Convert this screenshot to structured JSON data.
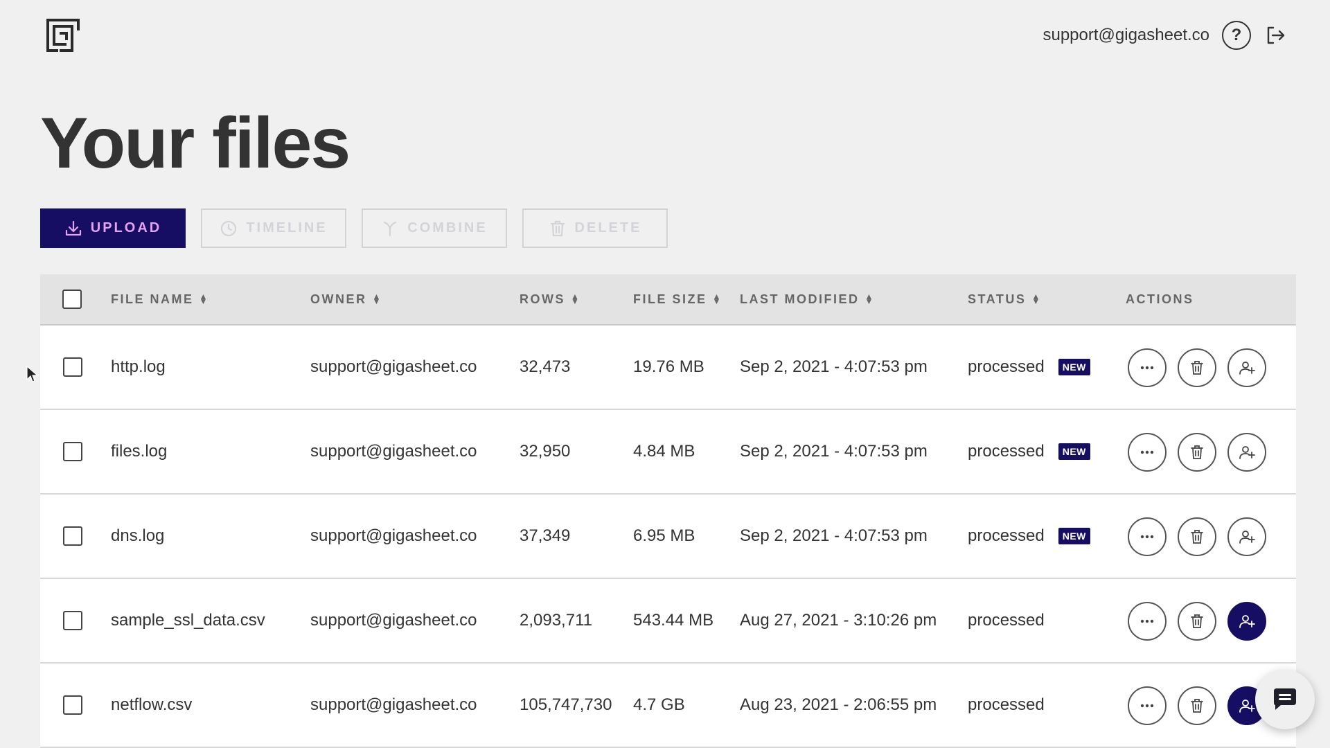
{
  "header": {
    "user_email": "support@gigasheet.co",
    "help_label": "?"
  },
  "page": {
    "title": "Your files"
  },
  "toolbar": {
    "upload": "UPLOAD",
    "timeline": "TIMELINE",
    "combine": "COMBINE",
    "delete": "DELETE"
  },
  "table": {
    "headers": {
      "file_name": "FILE NAME",
      "owner": "OWNER",
      "rows": "ROWS",
      "file_size": "FILE SIZE",
      "last_modified": "LAST MODIFIED",
      "status": "STATUS",
      "actions": "ACTIONS"
    },
    "rows": [
      {
        "name": "http.log",
        "owner": "support@gigasheet.co",
        "rows": "32,473",
        "size": "19.76 MB",
        "modified": "Sep 2, 2021 - 4:07:53 pm",
        "status": "processed",
        "badge": "NEW"
      },
      {
        "name": "files.log",
        "owner": "support@gigasheet.co",
        "rows": "32,950",
        "size": "4.84 MB",
        "modified": "Sep 2, 2021 - 4:07:53 pm",
        "status": "processed",
        "badge": "NEW"
      },
      {
        "name": "dns.log",
        "owner": "support@gigasheet.co",
        "rows": "37,349",
        "size": "6.95 MB",
        "modified": "Sep 2, 2021 - 4:07:53 pm",
        "status": "processed",
        "badge": "NEW"
      },
      {
        "name": "sample_ssl_data.csv",
        "owner": "support@gigasheet.co",
        "rows": "2,093,711",
        "size": "543.44 MB",
        "modified": "Aug 27, 2021 - 3:10:26 pm",
        "status": "processed",
        "badge": ""
      },
      {
        "name": "netflow.csv",
        "owner": "support@gigasheet.co",
        "rows": "105,747,730",
        "size": "4.7 GB",
        "modified": "Aug 23, 2021 - 2:06:55 pm",
        "status": "processed",
        "badge": ""
      }
    ]
  },
  "colors": {
    "primary": "#160e63",
    "upload_text": "#e7a3ef",
    "background": "#f0f0f0",
    "header_row": "#e3e3e3"
  }
}
